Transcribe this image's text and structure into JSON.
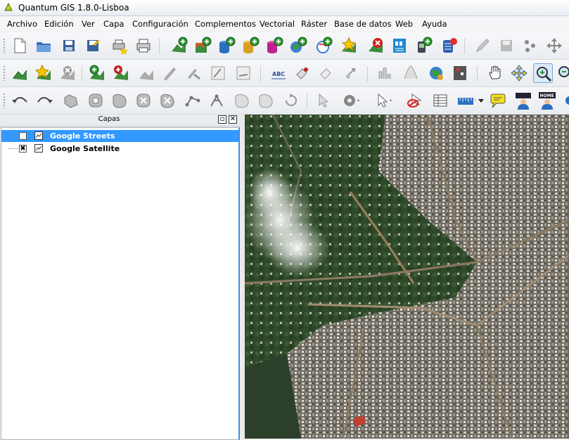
{
  "window": {
    "title": "Quantum GIS 1.8.0-Lisboa"
  },
  "menu": [
    "Archivo",
    "Edición",
    "Ver",
    "Capa",
    "Configuración",
    "Complementos",
    "Vectorial",
    "Ráster",
    "Base de datos",
    "Web",
    "Ayuda"
  ],
  "layers_panel": {
    "title": "Capas",
    "layers": [
      {
        "name": "Google Streets",
        "checked": false,
        "selected": true
      },
      {
        "name": "Google Satellite",
        "checked": true,
        "selected": false
      }
    ]
  },
  "toolbar": {
    "abc_label": "ABC",
    "home_label": "HOME",
    "home_icon": "home-icon"
  },
  "colors": {
    "selection": "#3399ff",
    "accent": "#2d8a2d"
  }
}
